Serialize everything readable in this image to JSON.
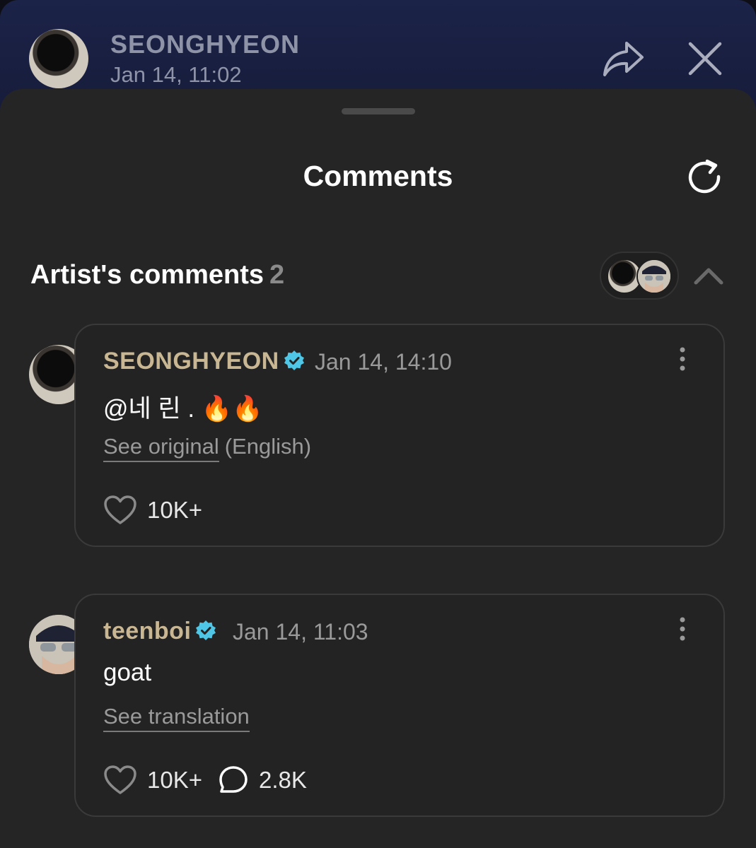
{
  "post_header": {
    "author": "SEONGHYEON",
    "time": "Jan 14, 11:02",
    "share_icon": "share-arrow-icon",
    "close_icon": "close-icon"
  },
  "sheet": {
    "title": "Comments",
    "refresh_icon": "refresh-icon"
  },
  "section": {
    "title": "Artist's comments",
    "count": "2",
    "collapse_icon": "chevron-up-icon"
  },
  "comments": [
    {
      "author": "SEONGHYEON",
      "verified": true,
      "time": "Jan 14, 14:10",
      "body": "@네 린 . 🔥🔥",
      "link": "See original",
      "link_suffix": "(English)",
      "likes": "10K+"
    },
    {
      "author": "teenboi",
      "verified": true,
      "time": "Jan 14, 11:03",
      "body": "goat",
      "link": "See translation",
      "likes": "10K+",
      "replies": "2.8K"
    }
  ],
  "colors": {
    "accent_name": "#c9b692",
    "verified_badge": "#4fc6e6",
    "sheet_bg": "#252525",
    "card_bg": "#232323"
  }
}
